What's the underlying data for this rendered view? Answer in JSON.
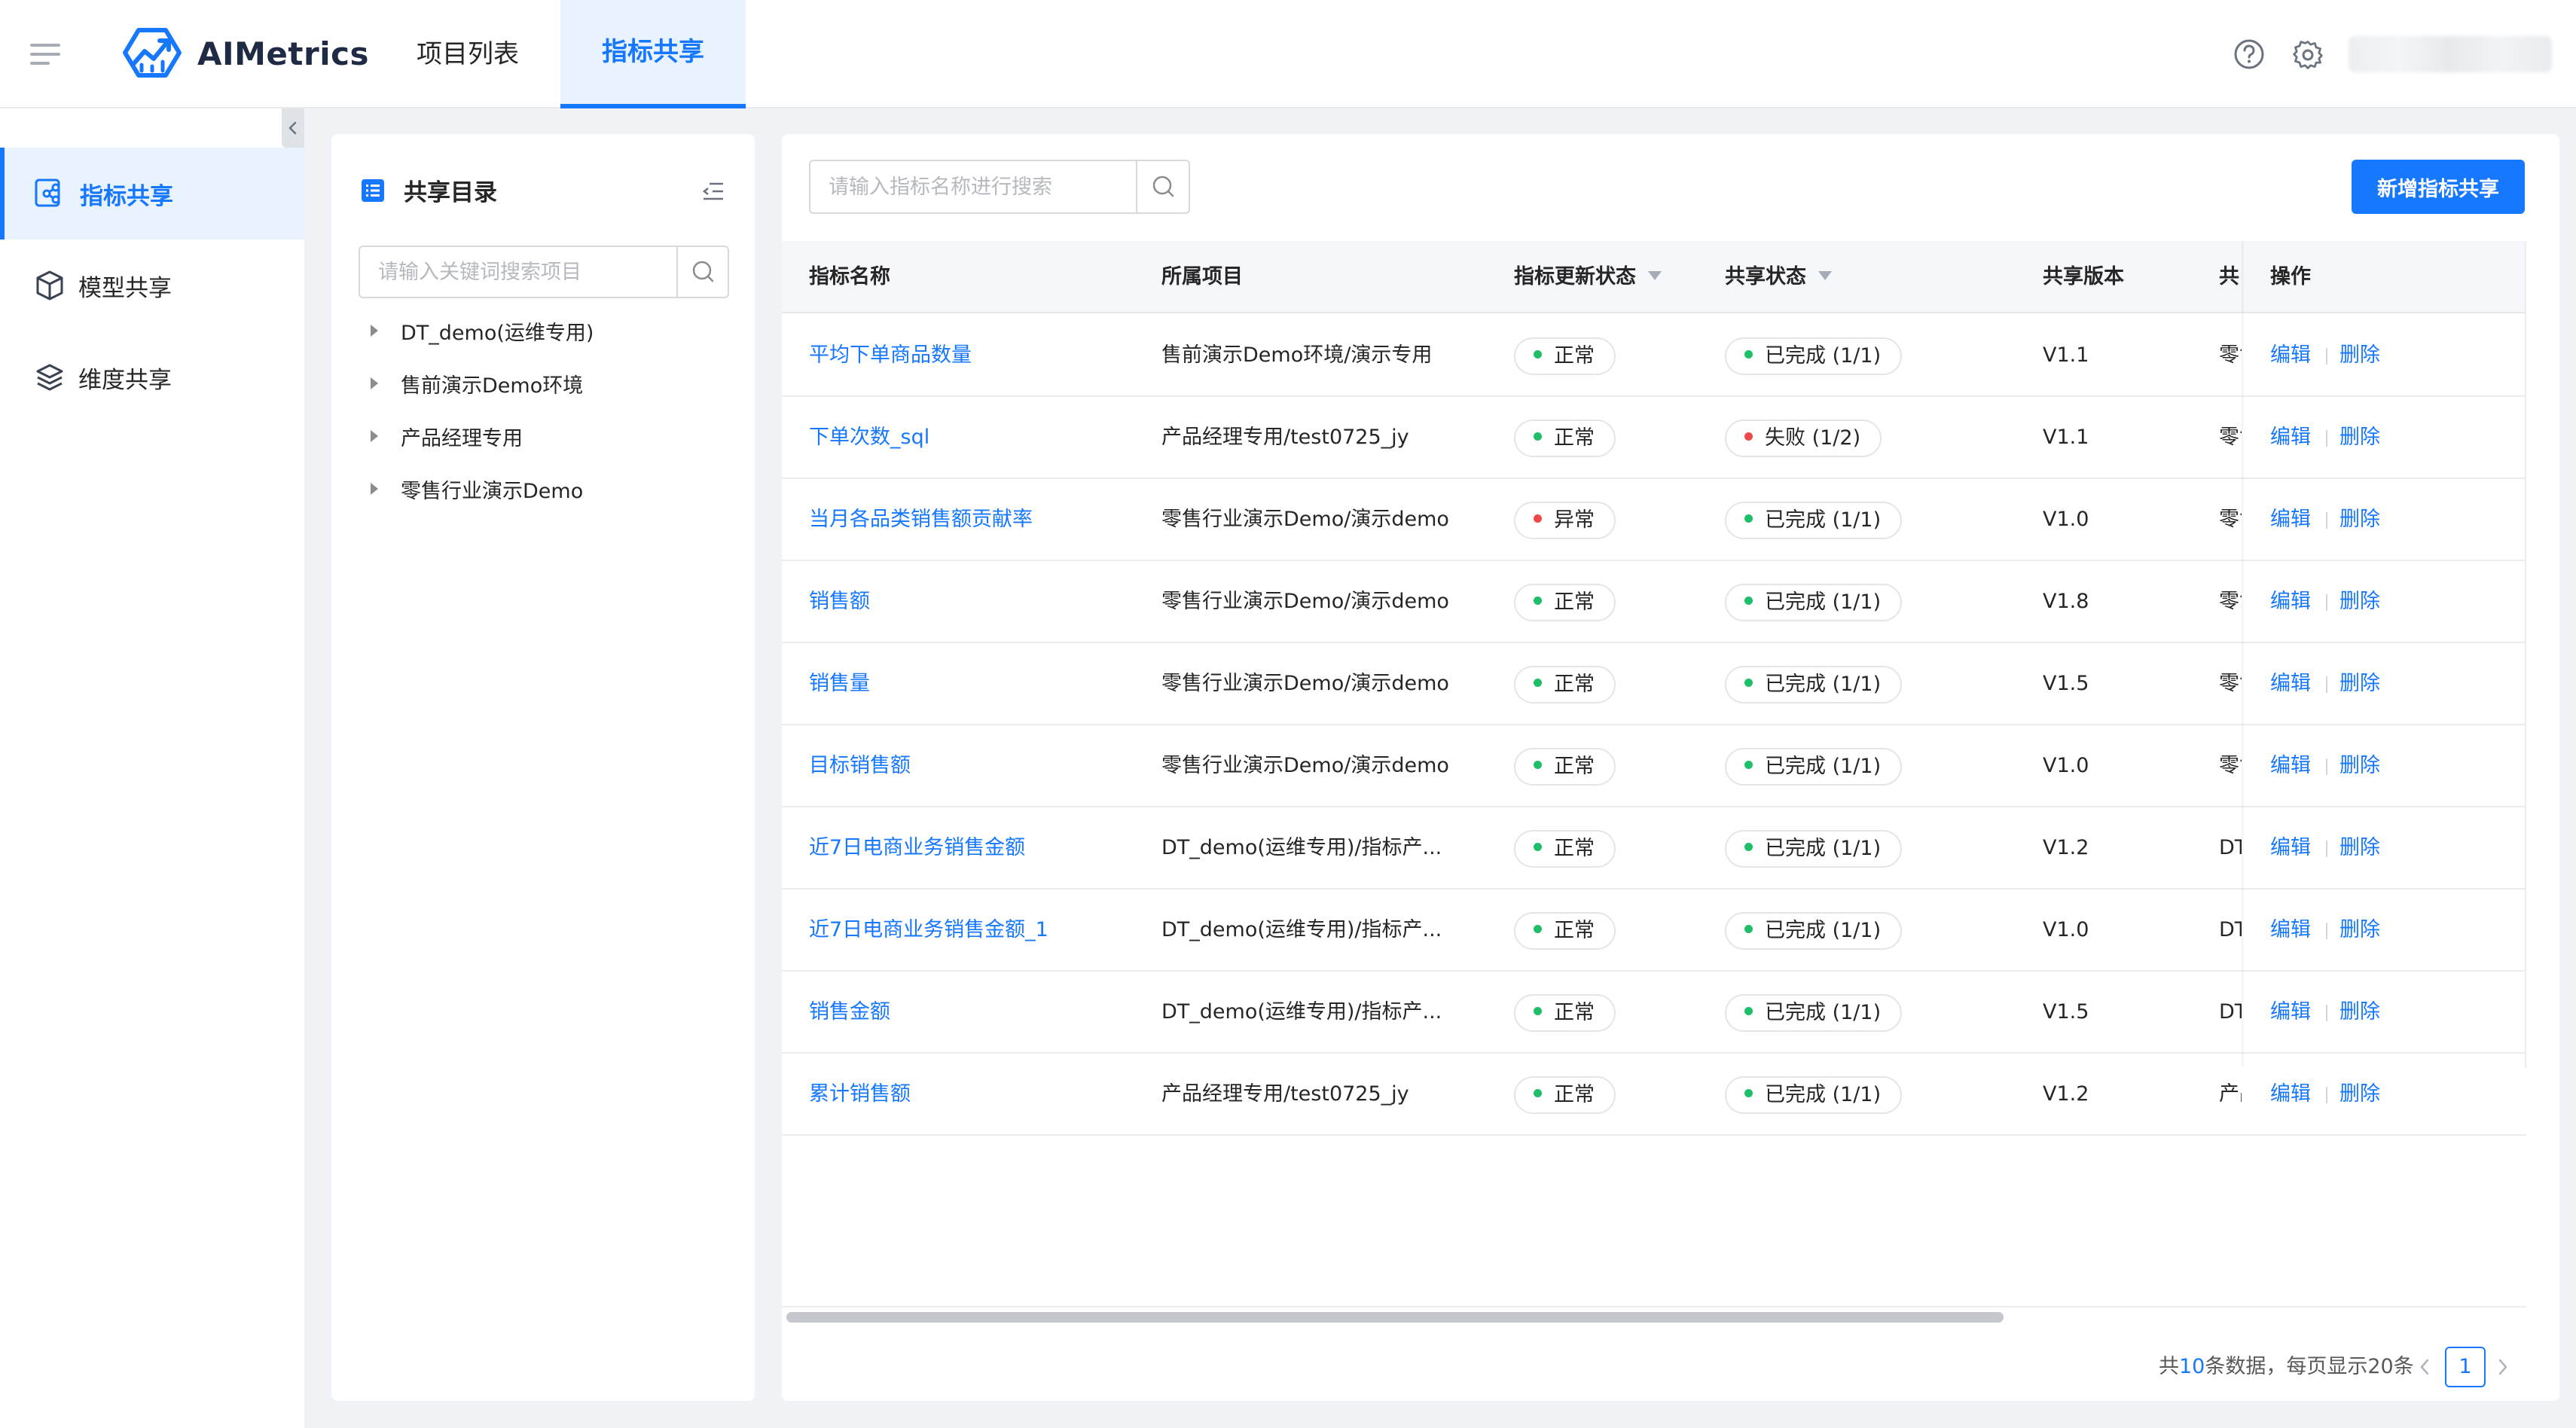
{
  "header": {
    "brand": "AIMetrics",
    "nav": [
      "项目列表",
      "指标共享"
    ],
    "active_nav": "指标共享"
  },
  "sidebar": {
    "items": [
      {
        "label": "指标共享",
        "icon": "metric-share-icon",
        "active": true
      },
      {
        "label": "模型共享",
        "icon": "cube-icon",
        "active": false
      },
      {
        "label": "维度共享",
        "icon": "layers-icon",
        "active": false
      }
    ]
  },
  "catalog": {
    "title": "共享目录",
    "search_placeholder": "请输入关键词搜索项目",
    "tree": [
      "DT_demo(运维专用)",
      "售前演示Demo环境",
      "产品经理专用",
      "零售行业演示Demo"
    ]
  },
  "main": {
    "search_placeholder": "请输入指标名称进行搜索",
    "add_button": "新增指标共享",
    "columns": [
      "指标名称",
      "所属项目",
      "指标更新状态",
      "共享状态",
      "共享版本",
      "共",
      "操作"
    ],
    "rows": [
      {
        "name": "平均下单商品数量",
        "project": "售前演示Demo环境/演示专用",
        "update_status": "正常",
        "update_ok": true,
        "share_status": "已完成 (1/1)",
        "share_ok": true,
        "version": "V1.1",
        "extra": "零售"
      },
      {
        "name": "下单次数_sql",
        "project": "产品经理专用/test0725_jy",
        "update_status": "正常",
        "update_ok": true,
        "share_status": "失败 (1/2)",
        "share_ok": false,
        "version": "V1.1",
        "extra": "零售"
      },
      {
        "name": "当月各品类销售额贡献率",
        "project": "零售行业演示Demo/演示demo",
        "update_status": "异常",
        "update_ok": false,
        "share_status": "已完成 (1/1)",
        "share_ok": true,
        "version": "V1.0",
        "extra": "零售"
      },
      {
        "name": "销售额",
        "project": "零售行业演示Demo/演示demo",
        "update_status": "正常",
        "update_ok": true,
        "share_status": "已完成 (1/1)",
        "share_ok": true,
        "version": "V1.8",
        "extra": "零售"
      },
      {
        "name": "销售量",
        "project": "零售行业演示Demo/演示demo",
        "update_status": "正常",
        "update_ok": true,
        "share_status": "已完成 (1/1)",
        "share_ok": true,
        "version": "V1.5",
        "extra": "零售"
      },
      {
        "name": "目标销售额",
        "project": "零售行业演示Demo/演示demo",
        "update_status": "正常",
        "update_ok": true,
        "share_status": "已完成 (1/1)",
        "share_ok": true,
        "version": "V1.0",
        "extra": "零售"
      },
      {
        "name": "近7日电商业务销售金额",
        "project": "DT_demo(运维专用)/指标产...",
        "update_status": "正常",
        "update_ok": true,
        "share_status": "已完成 (1/1)",
        "share_ok": true,
        "version": "V1.2",
        "extra": "DT"
      },
      {
        "name": "近7日电商业务销售金额_1",
        "project": "DT_demo(运维专用)/指标产...",
        "update_status": "正常",
        "update_ok": true,
        "share_status": "已完成 (1/1)",
        "share_ok": true,
        "version": "V1.0",
        "extra": "DT"
      },
      {
        "name": "销售金额",
        "project": "DT_demo(运维专用)/指标产...",
        "update_status": "正常",
        "update_ok": true,
        "share_status": "已完成 (1/1)",
        "share_ok": true,
        "version": "V1.5",
        "extra": "DT"
      },
      {
        "name": "累计销售额",
        "project": "产品经理专用/test0725_jy",
        "update_status": "正常",
        "update_ok": true,
        "share_status": "已完成 (1/1)",
        "share_ok": true,
        "version": "V1.2",
        "extra": "产品"
      }
    ],
    "actions": {
      "edit": "编辑",
      "delete": "删除"
    },
    "pagination": {
      "prefix": "共",
      "total": "10",
      "suffix": "条数据，每页显示20条",
      "current": "1"
    }
  },
  "colors": {
    "accent": "#1677ff",
    "ok": "#1fbf6a",
    "error": "#f04848"
  }
}
